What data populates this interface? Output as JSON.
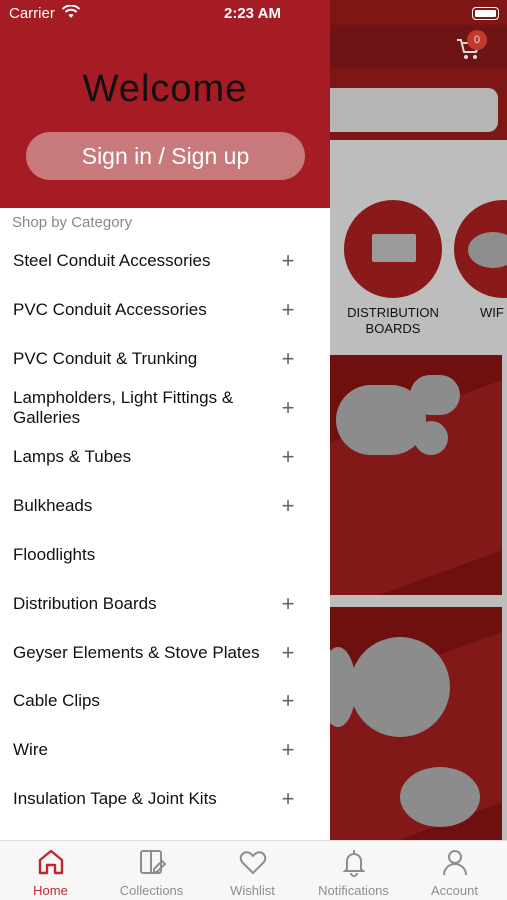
{
  "status_bar": {
    "carrier": "Carrier",
    "time": "2:23 AM"
  },
  "background": {
    "cart_count": "0",
    "categories": [
      {
        "label": "DISTRIBUTION BOARDS"
      },
      {
        "label": "WIF"
      }
    ]
  },
  "drawer": {
    "welcome": "Welcome",
    "signin_label": "Sign in / Sign up",
    "section_title": "Shop by Category",
    "categories": [
      {
        "label": "Steel Conduit Accessories",
        "expandable": true
      },
      {
        "label": "PVC Conduit Accessories",
        "expandable": true
      },
      {
        "label": "PVC Conduit & Trunking",
        "expandable": true
      },
      {
        "label": "Lampholders, Light Fittings & Galleries",
        "expandable": true
      },
      {
        "label": "Lamps & Tubes",
        "expandable": true
      },
      {
        "label": "Bulkheads",
        "expandable": true
      },
      {
        "label": "Floodlights",
        "expandable": false
      },
      {
        "label": "Distribution Boards",
        "expandable": true
      },
      {
        "label": "Geyser Elements & Stove Plates",
        "expandable": true
      },
      {
        "label": "Cable Clips",
        "expandable": true
      },
      {
        "label": "Wire",
        "expandable": true
      },
      {
        "label": "Insulation Tape & Joint Kits",
        "expandable": true
      }
    ],
    "expand_glyph": "+"
  },
  "tabbar": {
    "tabs": [
      {
        "label": "Home",
        "icon": "home-icon",
        "active": true
      },
      {
        "label": "Collections",
        "icon": "collections-icon",
        "active": false
      },
      {
        "label": "Wishlist",
        "icon": "heart-icon",
        "active": false
      },
      {
        "label": "Notifications",
        "icon": "bell-icon",
        "active": false
      },
      {
        "label": "Account",
        "icon": "person-icon",
        "active": false
      }
    ]
  },
  "colors": {
    "brand_red": "#a51c24",
    "active_tab": "#c0262d",
    "signin_button": "#c8797c"
  }
}
